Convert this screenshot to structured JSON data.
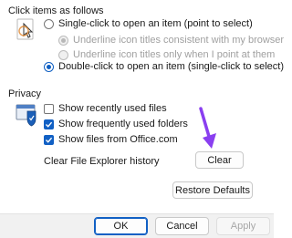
{
  "click_section": {
    "title": "Click items as follows",
    "single_click": "Single-click to open an item (point to select)",
    "underline_browser": "Underline icon titles consistent with my browser",
    "underline_point": "Underline icon titles only when I point at them",
    "double_click": "Double-click to open an item (single-click to select)"
  },
  "privacy_section": {
    "title": "Privacy",
    "show_recent": "Show recently used files",
    "show_frequent": "Show frequently used folders",
    "show_office": "Show files from Office.com",
    "clear_history_label": "Clear File Explorer history",
    "clear_button": "Clear"
  },
  "restore_button": "Restore Defaults",
  "footer": {
    "ok": "OK",
    "cancel": "Cancel",
    "apply": "Apply"
  },
  "colors": {
    "accent": "#1160c4",
    "annotation_arrow": "#8a3ff0"
  }
}
